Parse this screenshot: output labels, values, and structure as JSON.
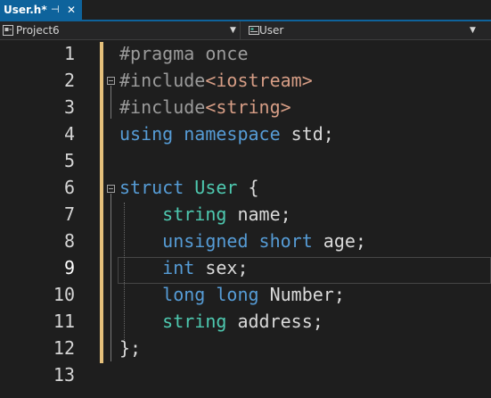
{
  "tab": {
    "title": "User.h*",
    "pin_glyph": "⊣",
    "close_glyph": "✕"
  },
  "navbar": {
    "project": "Project6",
    "scope": "User"
  },
  "editor": {
    "current_line": 9,
    "line_numbers": [
      "1",
      "2",
      "3",
      "4",
      "5",
      "6",
      "7",
      "8",
      "9",
      "10",
      "11",
      "12",
      "13"
    ],
    "lines": [
      [
        {
          "t": "#pragma once",
          "c": "pp"
        }
      ],
      [
        {
          "t": "#include",
          "c": "pp"
        },
        {
          "t": "<iostream>",
          "c": "inc"
        }
      ],
      [
        {
          "t": "#include",
          "c": "pp"
        },
        {
          "t": "<string>",
          "c": "inc"
        }
      ],
      [
        {
          "t": "using",
          "c": "kw"
        },
        {
          "t": " ",
          "c": "id"
        },
        {
          "t": "namespace",
          "c": "kw"
        },
        {
          "t": " std;",
          "c": "id"
        }
      ],
      [],
      [
        {
          "t": "struct",
          "c": "kw"
        },
        {
          "t": " ",
          "c": "id"
        },
        {
          "t": "User",
          "c": "ty"
        },
        {
          "t": " {",
          "c": "id"
        }
      ],
      [
        {
          "t": "    ",
          "c": "id"
        },
        {
          "t": "string",
          "c": "ty"
        },
        {
          "t": " name;",
          "c": "id"
        }
      ],
      [
        {
          "t": "    ",
          "c": "id"
        },
        {
          "t": "unsigned",
          "c": "kw"
        },
        {
          "t": " ",
          "c": "id"
        },
        {
          "t": "short",
          "c": "kw"
        },
        {
          "t": " age;",
          "c": "id"
        }
      ],
      [
        {
          "t": "    ",
          "c": "id"
        },
        {
          "t": "int",
          "c": "kw"
        },
        {
          "t": " sex;",
          "c": "id"
        }
      ],
      [
        {
          "t": "    ",
          "c": "id"
        },
        {
          "t": "long",
          "c": "kw"
        },
        {
          "t": " ",
          "c": "id"
        },
        {
          "t": "long",
          "c": "kw"
        },
        {
          "t": " Number;",
          "c": "id"
        }
      ],
      [
        {
          "t": "    ",
          "c": "id"
        },
        {
          "t": "string",
          "c": "ty"
        },
        {
          "t": " address;",
          "c": "id"
        }
      ],
      [
        {
          "t": "};",
          "c": "id"
        }
      ],
      []
    ]
  },
  "colors": {
    "tab_active": "#0e639c",
    "keyword": "#569cd6",
    "type": "#4ec9b0",
    "preprocessor": "#9b9b9b",
    "include_path": "#d69d85",
    "change_marker": "#e5c07b"
  },
  "icons": {
    "project_icon": "project-icon",
    "scope_icon": "class-icon",
    "dropdown": "chevron-down-icon"
  }
}
